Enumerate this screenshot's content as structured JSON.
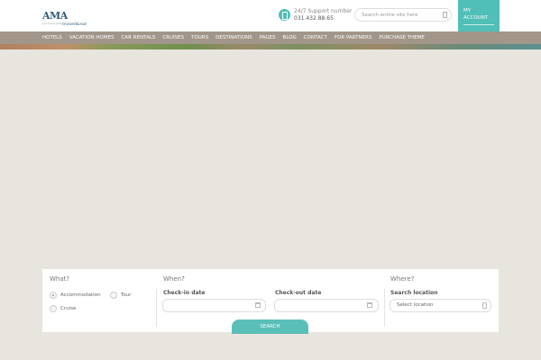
{
  "header": {
    "logo_main": "AMA",
    "logo_sub": "travel&eat",
    "logo_tagline": "your travel guide",
    "support_label": "24/7 Support number",
    "support_number": "031.432.88.65",
    "search_placeholder": "Search entire site here",
    "account_line1": "MY",
    "account_line2": "ACCOUNT"
  },
  "nav": {
    "items": [
      "HOTELS",
      "VACATION HOMES",
      "CAR RENTALS",
      "CRUISES",
      "TOURS",
      "DESTINATIONS",
      "PAGES",
      "BLOG",
      "CONTACT",
      "FOR PARTNERS",
      "PURCHASE THEME"
    ]
  },
  "search_panel": {
    "what": {
      "label": "What?",
      "options": [
        "Accommodation",
        "Tour",
        "Cruise"
      ],
      "selected": "Accommodation"
    },
    "when": {
      "label": "When?",
      "checkin_label": "Check-in date",
      "checkout_label": "Check-out date"
    },
    "where": {
      "label": "Where?",
      "location_label": "Search location",
      "location_value": "Select location"
    },
    "search_button": "SEARCH"
  },
  "colors": {
    "accent": "#4fbfb8",
    "nav_background": "#a19689",
    "page_background": "#e8e5df"
  }
}
